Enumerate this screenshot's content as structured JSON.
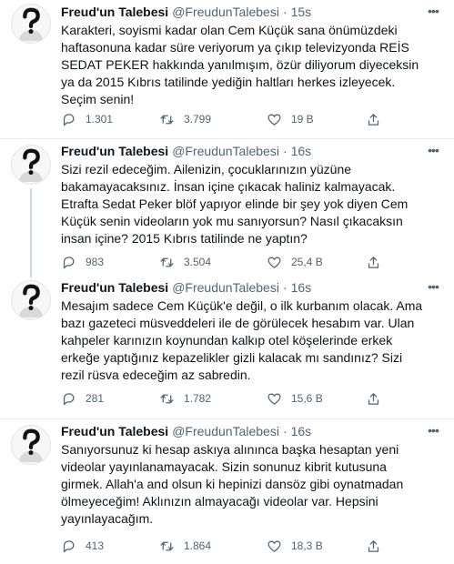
{
  "tweets": [
    {
      "author": "Freud'un Talebesi",
      "handle": "@FreudunTalebesi",
      "separator": "·",
      "time": "15s",
      "text": "Karakteri, soyismi kadar olan Cem Küçük sana önümüzdeki haftasonuna kadar süre veriyorum ya çıkıp televizyonda REİS SEDAT PEKER hakkında yanılmışım, özür diliyorum diyeceksin ya da 2015 Kıbrıs tatilinde yediğin haltları herkes izleyecek. Seçim senin!",
      "replies": "1.301",
      "retweets": "3.799",
      "likes": "19 B"
    },
    {
      "author": "Freud'un Talebesi",
      "handle": "@FreudunTalebesi",
      "separator": "·",
      "time": "16s",
      "text": "Sizi rezil edeceğim. Ailenizin, çocuklarınızın yüzüne bakamayacaksınız. İnsan içine çıkacak haliniz kalmayacak. Etrafta Sedat Peker blöf yapıyor elinde bir şey yok diyen Cem Küçük senin videoların yok mu sanıyorsun? Nasıl çıkacaksın insan içine? 2015 Kıbrıs tatilinde ne yaptın?",
      "replies": "983",
      "retweets": "3.504",
      "likes": "25,4 B"
    },
    {
      "author": "Freud'un Talebesi",
      "handle": "@FreudunTalebesi",
      "separator": "·",
      "time": "16s",
      "text": "Mesajım sadece Cem Küçük'e değil, o ilk kurbanım olacak. Ama bazı gazeteci müsveddeleri ile de görülecek hesabım var. Ulan kahpeler karınızın koynundan kalkıp otel köşelerinde erkek erkeğe yaptığınız kepazelikler gizli kalacak mı sandınız? Sizi rezil rüsva edeceğim az sabredin.",
      "replies": "281",
      "retweets": "1.782",
      "likes": "15,6 B"
    },
    {
      "author": "Freud'un Talebesi",
      "handle": "@FreudunTalebesi",
      "separator": "·",
      "time": "16s",
      "text": "Sanıyorsunuz ki hesap askıya alınınca başka hesaptan yeni videolar yayınlanamayacak. Sizin sonunuz kibrit kutusuna girmek. Allah'a and olsun ki hepinizi dansöz gibi oynatmadan ölmeyeceğim! Aklınızın almayacağı videolar var. Hepsini yayınlayacağım.",
      "replies": "413",
      "retweets": "1.864",
      "likes": "18,3 B"
    }
  ],
  "icons": {
    "reply": "reply-icon",
    "retweet": "retweet-icon",
    "like": "like-icon",
    "share": "share-icon",
    "more": "more-icon"
  },
  "colors": {
    "text": "#0f1419",
    "secondary": "#536471",
    "divider": "#e6ecf0",
    "thread": "#cfd9de"
  }
}
